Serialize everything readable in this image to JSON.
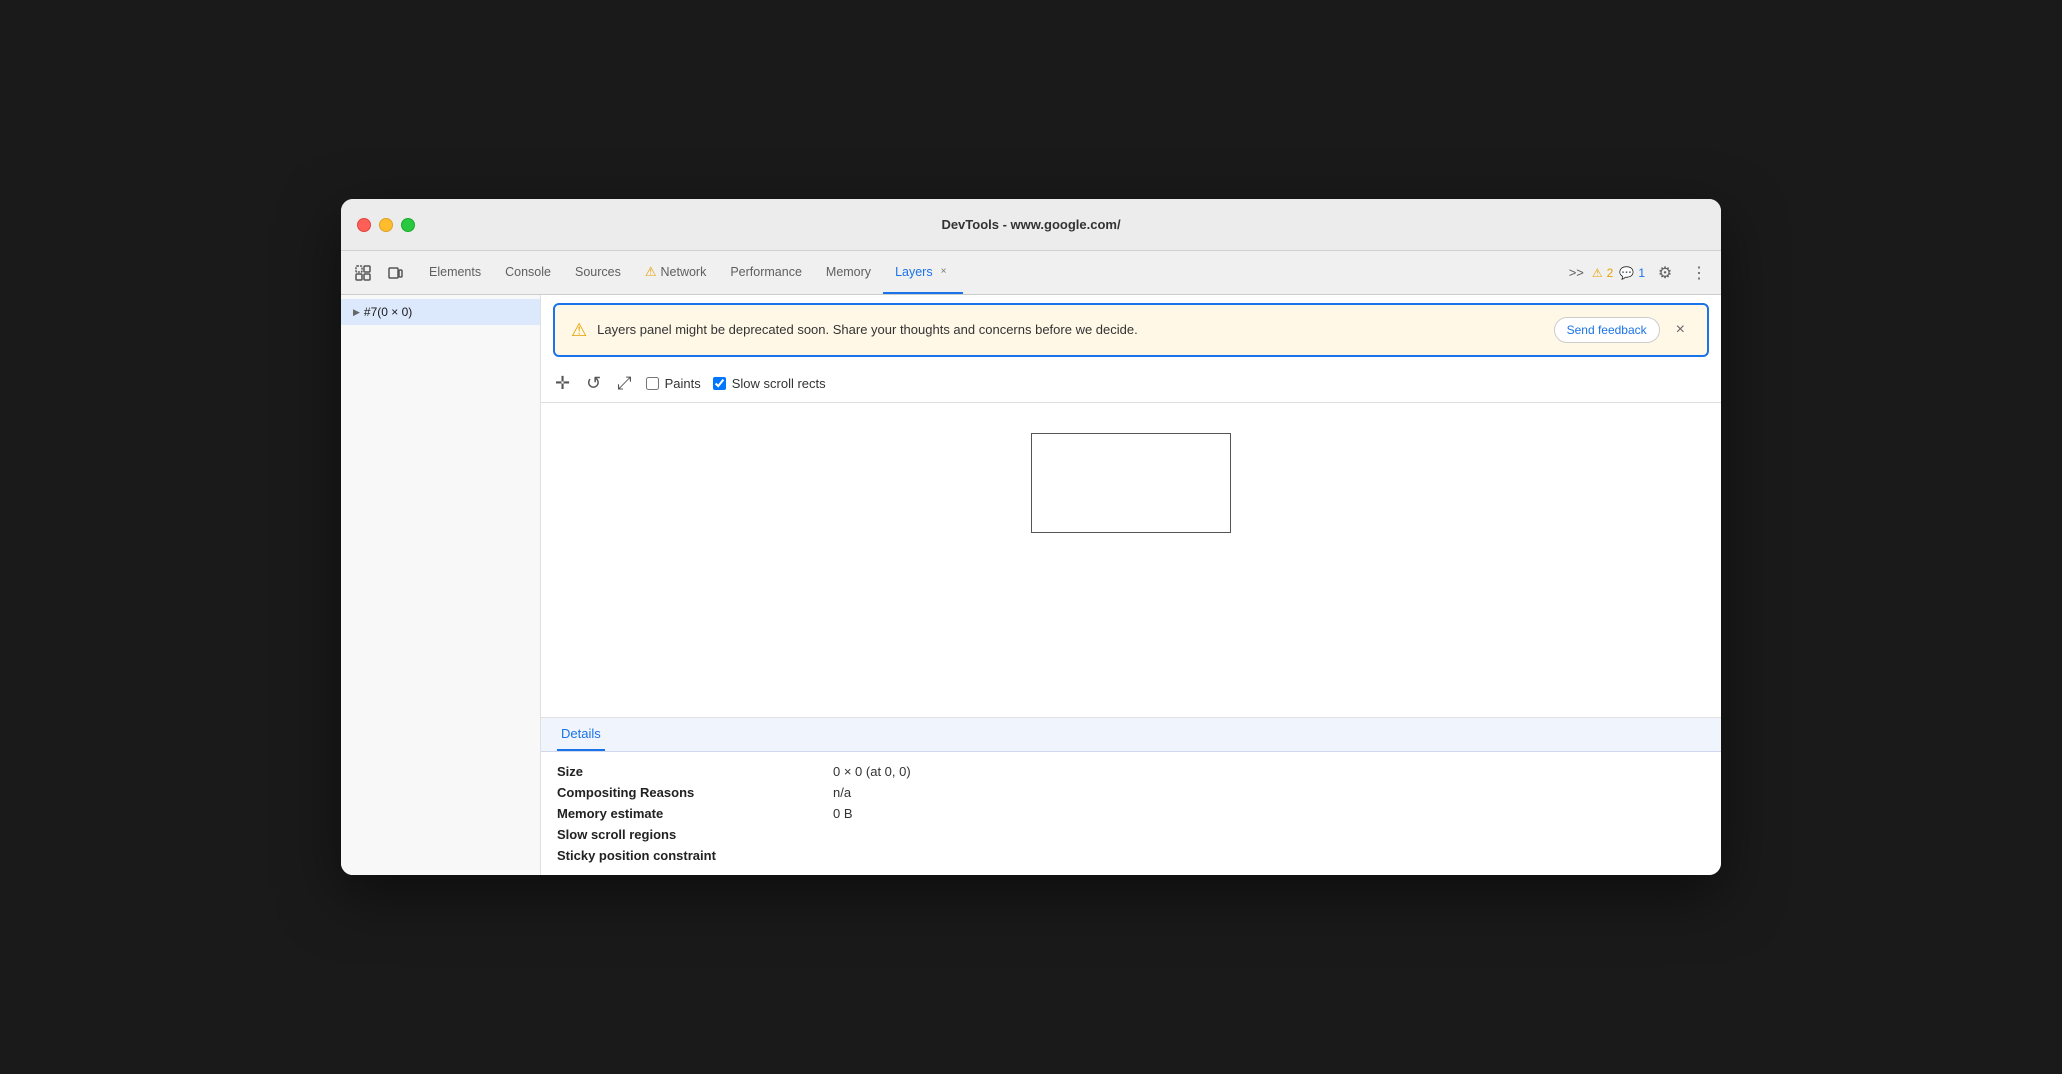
{
  "window": {
    "title": "DevTools - www.google.com/"
  },
  "traffic_lights": {
    "red": "close",
    "yellow": "minimize",
    "green": "maximize"
  },
  "tabs": {
    "items": [
      {
        "id": "elements",
        "label": "Elements",
        "active": false,
        "icon": null,
        "closeable": false
      },
      {
        "id": "console",
        "label": "Console",
        "active": false,
        "icon": null,
        "closeable": false
      },
      {
        "id": "sources",
        "label": "Sources",
        "active": false,
        "icon": null,
        "closeable": false
      },
      {
        "id": "network",
        "label": "Network",
        "active": false,
        "icon": "⚠",
        "closeable": false
      },
      {
        "id": "performance",
        "label": "Performance",
        "active": false,
        "icon": null,
        "closeable": false
      },
      {
        "id": "memory",
        "label": "Memory",
        "active": false,
        "icon": null,
        "closeable": false
      },
      {
        "id": "layers",
        "label": "Layers",
        "active": true,
        "icon": null,
        "closeable": true
      }
    ],
    "overflow_label": ">>",
    "warnings_count": "2",
    "info_count": "1"
  },
  "toolbar": {
    "inspect_icon": "⣿",
    "device_icon": "▭",
    "settings_icon": "⚙",
    "more_icon": "⋮"
  },
  "layers_toolbar": {
    "move_icon": "✛",
    "rotate_icon": "↺",
    "resize_icon": "⤢",
    "paints_label": "Paints",
    "paints_checked": false,
    "slow_scroll_label": "Slow scroll rects",
    "slow_scroll_checked": true
  },
  "banner": {
    "warning_icon": "⚠",
    "message": "Layers panel might be deprecated soon. Share your thoughts and concerns before we decide.",
    "send_feedback_label": "Send feedback",
    "close_icon": "×"
  },
  "sidebar": {
    "items": [
      {
        "id": "layer1",
        "label": "#7(0 × 0)",
        "selected": true,
        "arrow": "▶"
      }
    ]
  },
  "details": {
    "tab_label": "Details",
    "rows": [
      {
        "label": "Size",
        "value": "0 × 0 (at 0, 0)"
      },
      {
        "label": "Compositing Reasons",
        "value": "n/a"
      },
      {
        "label": "Memory estimate",
        "value": "0 B"
      },
      {
        "label": "Slow scroll regions",
        "value": ""
      },
      {
        "label": "Sticky position constraint",
        "value": ""
      }
    ]
  }
}
